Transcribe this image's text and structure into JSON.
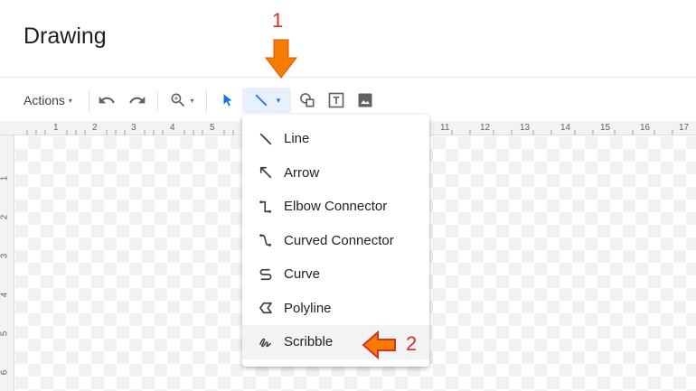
{
  "page": {
    "title": "Drawing"
  },
  "toolbar": {
    "actions_label": "Actions",
    "actions_caret": "▾",
    "zoom_caret": "▾",
    "line_caret": "▾"
  },
  "ruler": {
    "numbers": [
      "1",
      "2",
      "3",
      "4",
      "5",
      "11",
      "12",
      "13",
      "14",
      "15",
      "16",
      "17"
    ],
    "vertical_numbers": [
      "1",
      "2",
      "3",
      "4",
      "5",
      "6"
    ]
  },
  "line_menu": {
    "items": [
      {
        "label": "Line",
        "icon": "line-icon"
      },
      {
        "label": "Arrow",
        "icon": "arrow-icon"
      },
      {
        "label": "Elbow Connector",
        "icon": "elbow-connector-icon"
      },
      {
        "label": "Curved Connector",
        "icon": "curved-connector-icon"
      },
      {
        "label": "Curve",
        "icon": "curve-icon"
      },
      {
        "label": "Polyline",
        "icon": "polyline-icon"
      },
      {
        "label": "Scribble",
        "icon": "scribble-icon"
      }
    ],
    "hovered": "Scribble"
  },
  "annotations": {
    "step1": "1",
    "step2": "2"
  },
  "colors": {
    "accent": "#1a73e8",
    "annotation": "#d93025",
    "arrow_fill": "#f57c00"
  }
}
